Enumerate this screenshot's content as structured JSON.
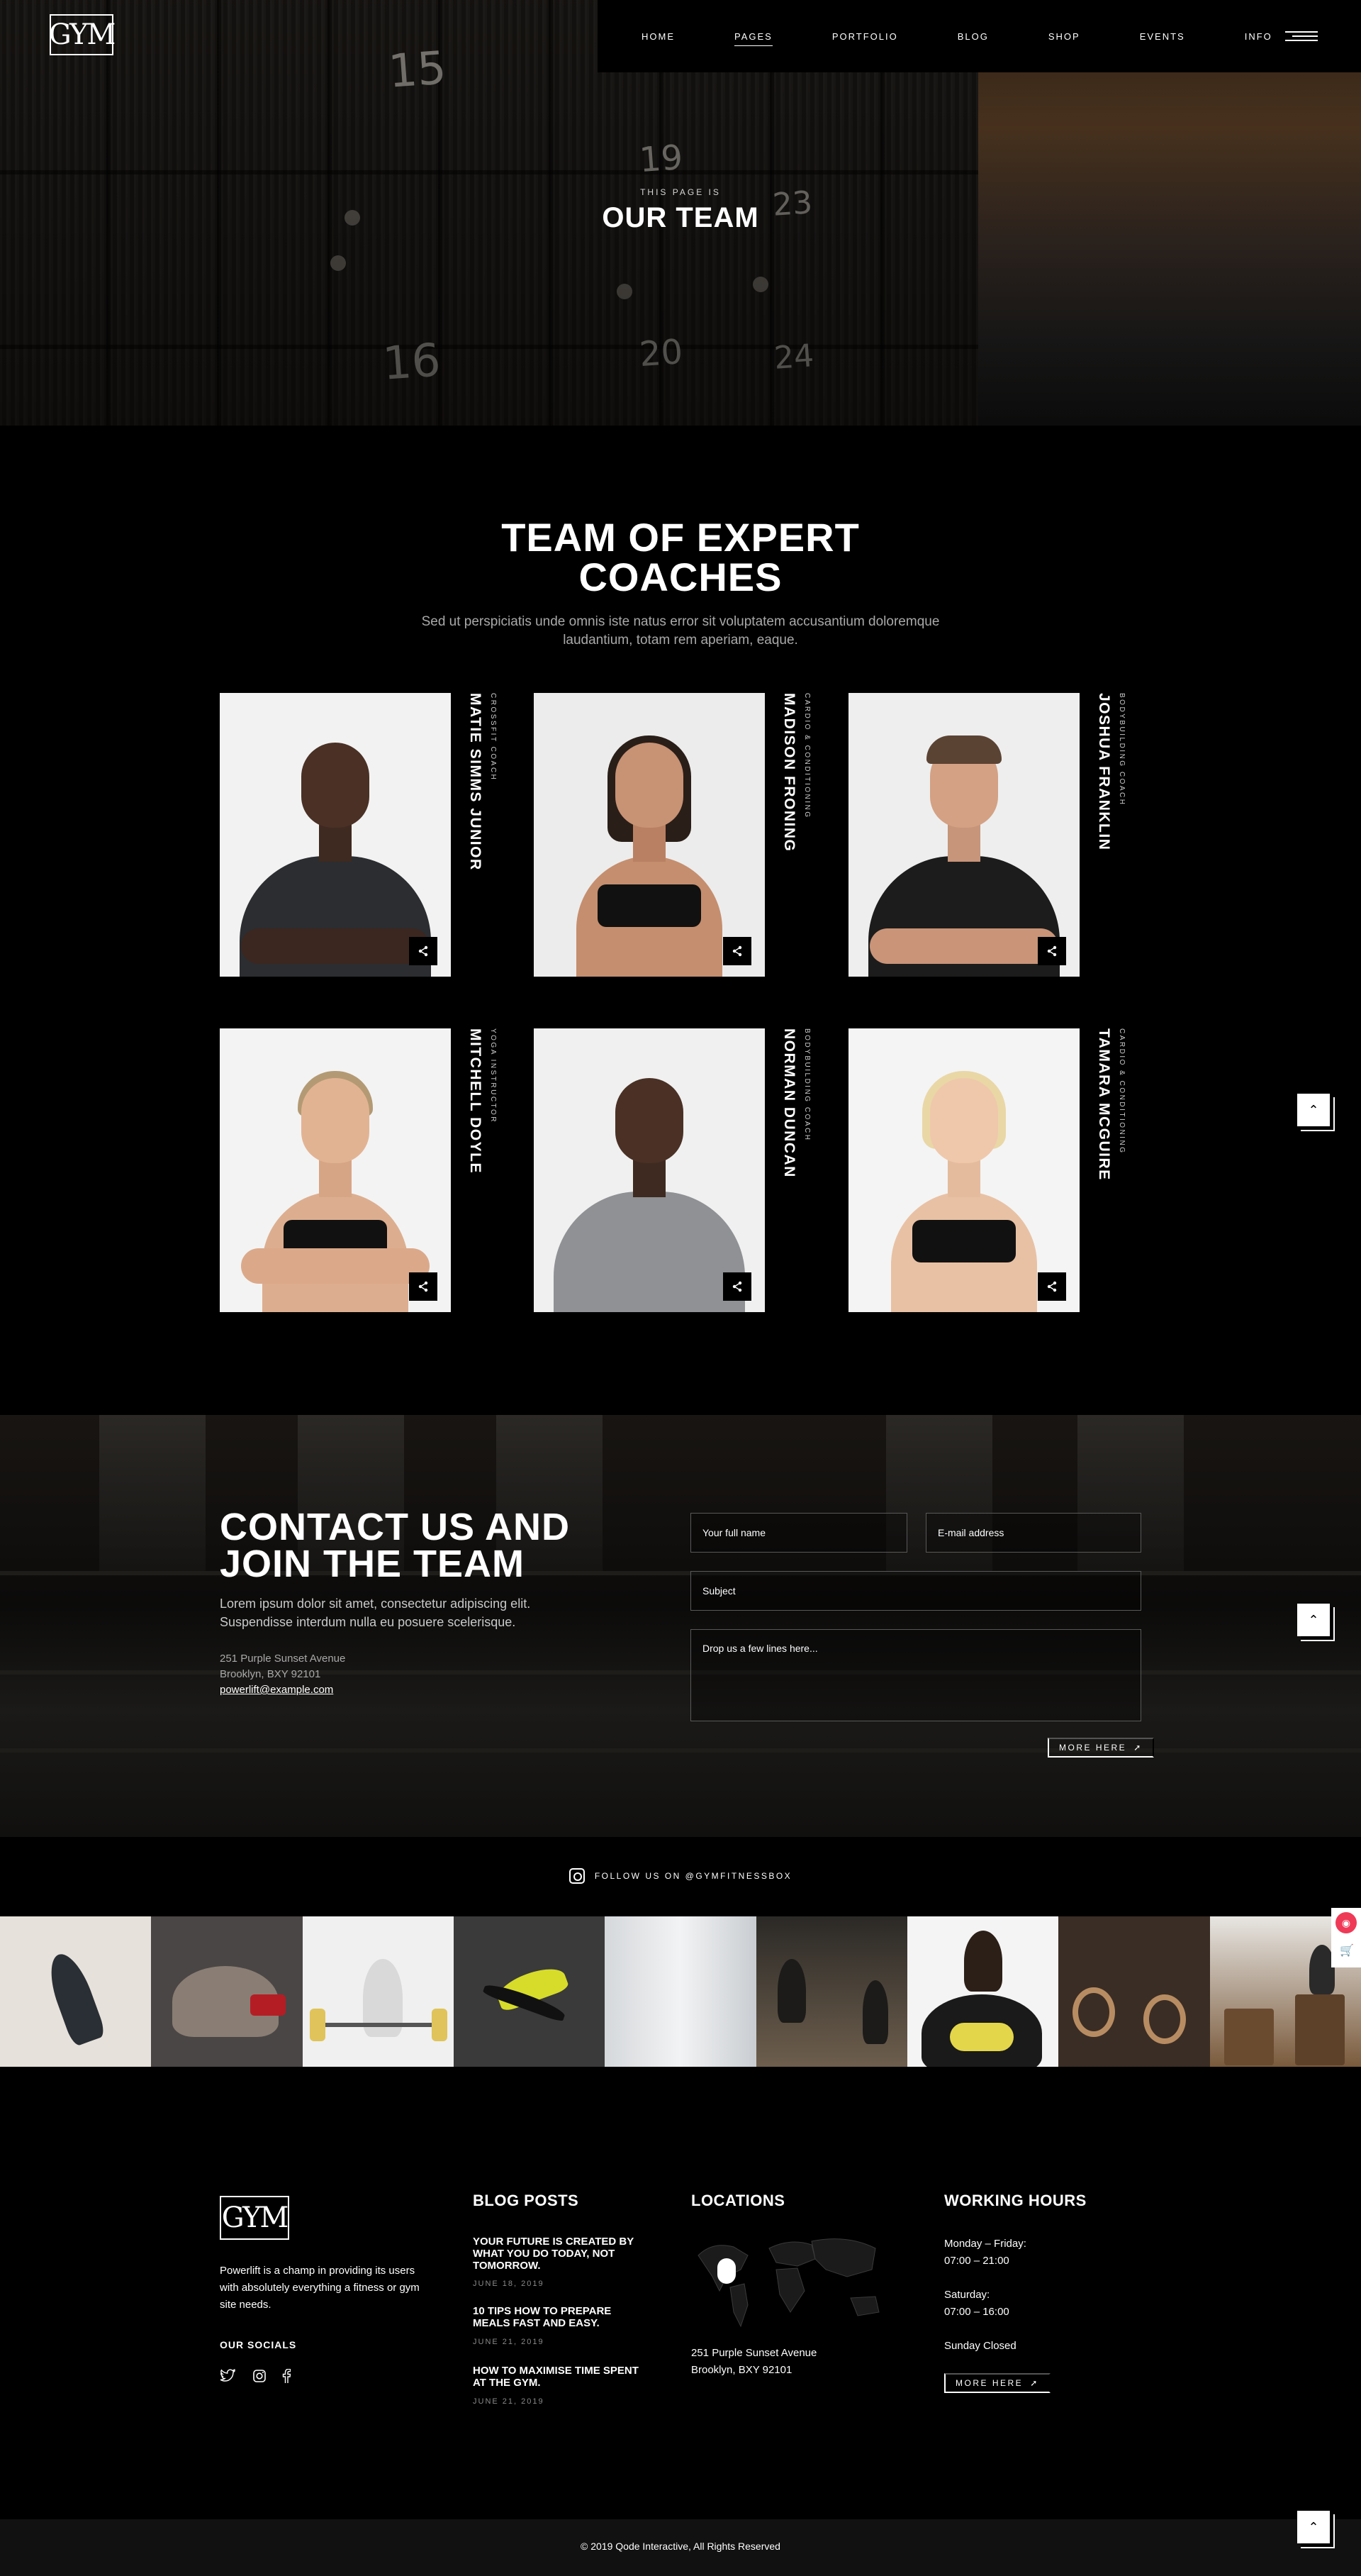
{
  "header": {
    "logo": "GYM",
    "nav": [
      "HOME",
      "PAGES",
      "PORTFOLIO",
      "BLOG",
      "SHOP",
      "EVENTS",
      "INFO"
    ],
    "active": "PAGES"
  },
  "hero": {
    "subtitle": "THIS PAGE IS",
    "title": "OUR TEAM",
    "locker_numbers": [
      "15",
      "19",
      "23",
      "16",
      "20",
      "24"
    ]
  },
  "team": {
    "title_line1": "TEAM OF EXPERT",
    "title_line2": "COACHES",
    "intro": "Sed ut perspiciatis unde omnis iste natus error sit voluptatem accusantium doloremque laudantium, totam rem aperiam, eaque.",
    "members": [
      {
        "name": "MATIE SIMMS JUNIOR",
        "role": "CROSSFIT COACH"
      },
      {
        "name": "MADISON FRONING",
        "role": "CARDIO & CONDITIONING"
      },
      {
        "name": "JOSHUA FRANKLIN",
        "role": "BODYBUILDING COACH"
      },
      {
        "name": "MITCHELL DOYLE",
        "role": "YOGA INSTRUCTOR"
      },
      {
        "name": "NORMAN DUNCAN",
        "role": "BODYBUILDING COACH"
      },
      {
        "name": "TAMARA MCGUIRE",
        "role": "CARDIO & CONDITIONING"
      }
    ]
  },
  "contact": {
    "title_line1": "CONTACT US AND",
    "title_line2": "JOIN THE TEAM",
    "text": "Lorem ipsum dolor sit amet, consectetur adipiscing elit. Suspendisse interdum nulla eu posuere scelerisque.",
    "address_line1": "251 Purple Sunset Avenue",
    "address_line2": "Brooklyn, BXY 92101",
    "email": "powerlift@example.com",
    "form": {
      "name_placeholder": "Your full name",
      "email_placeholder": "E-mail address",
      "subject_placeholder": "Subject",
      "message_placeholder": "Drop us a few lines here...",
      "submit": "MORE HERE"
    }
  },
  "instagram": {
    "follow": "FOLLOW US ON @GYMFITNESSBOX"
  },
  "footer": {
    "logo": "GYM",
    "about": "Powerlift is a champ in providing its users with absolutely everything a fitness or gym site needs.",
    "socials_title": "OUR SOCIALS",
    "blog_title": "BLOG POSTS",
    "posts": [
      {
        "title": "YOUR FUTURE IS CREATED BY WHAT YOU DO TODAY, NOT TOMORROW.",
        "date": "JUNE 18, 2019"
      },
      {
        "title": "10 TIPS HOW TO PREPARE MEALS FAST AND EASY.",
        "date": "JUNE 21, 2019"
      },
      {
        "title": "HOW TO MAXIMISE TIME SPENT AT THE GYM.",
        "date": "JUNE 21, 2019"
      }
    ],
    "locations_title": "LOCATIONS",
    "location_line1": "251 Purple Sunset Avenue",
    "location_line2": "Brooklyn, BXY 92101",
    "hours_title": "WORKING HOURS",
    "hours": {
      "weekday_label": "Monday – Friday:",
      "weekday_time": "07:00 – 21:00",
      "saturday_label": "Saturday:",
      "saturday_time": "07:00 – 16:00",
      "sunday": "Sunday Closed"
    },
    "more": "MORE HERE",
    "copyright": "© 2019 Qode Interactive, All Rights Reserved"
  },
  "colors": {
    "background": "#000000",
    "accent": "#ef3a57",
    "text": "#ffffff",
    "muted": "#a9a9a9"
  },
  "icons": [
    "share-icon",
    "arrow-up-icon",
    "instagram-icon",
    "twitter-icon",
    "facebook-icon",
    "menu-icon",
    "cart-icon",
    "map-pin-icon"
  ]
}
